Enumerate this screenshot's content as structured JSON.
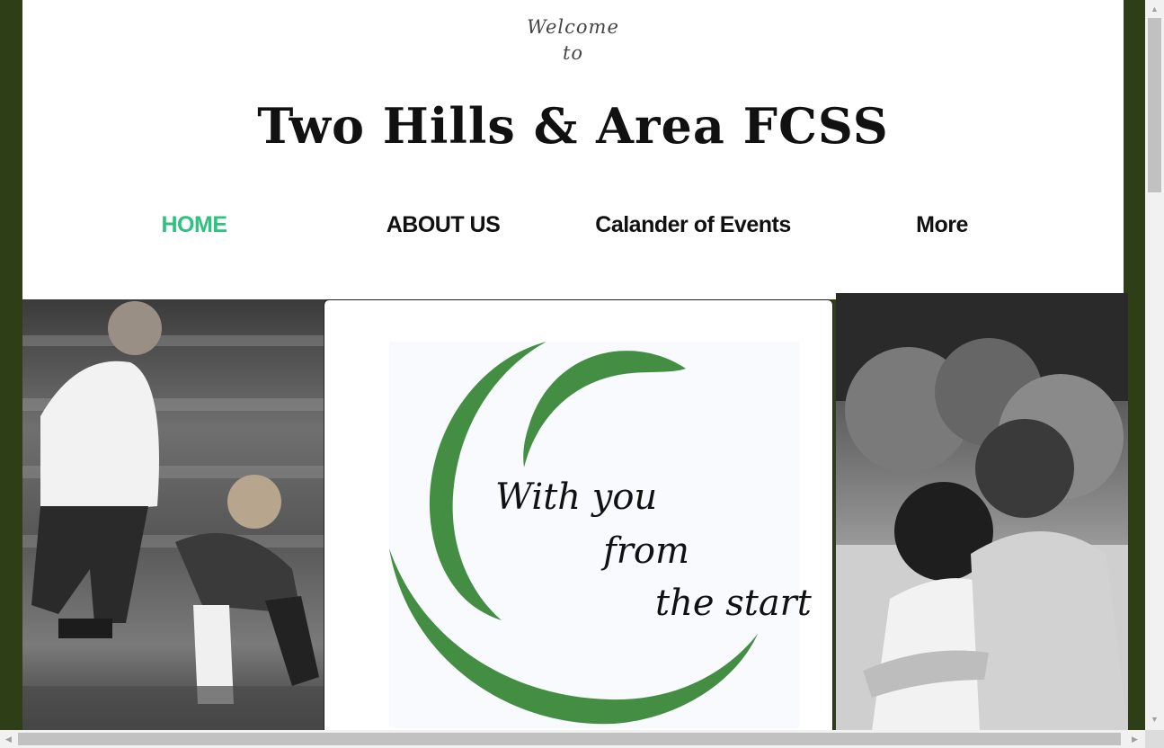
{
  "header": {
    "welcome_line1": "Welcome",
    "welcome_line2": "to",
    "site_title": "Two Hills & Area FCSS"
  },
  "nav": {
    "items": [
      {
        "label": "HOME",
        "active": true
      },
      {
        "label": "ABOUT US",
        "active": false
      },
      {
        "label": "Calander of Events",
        "active": false
      },
      {
        "label": "More",
        "active": false
      }
    ]
  },
  "logo": {
    "tagline_line1": "With you",
    "tagline_line2": "from",
    "tagline_line3": "the start"
  },
  "colors": {
    "background": "#2e3e16",
    "accent": "#2ec27e",
    "logo_green": "#438e43"
  }
}
